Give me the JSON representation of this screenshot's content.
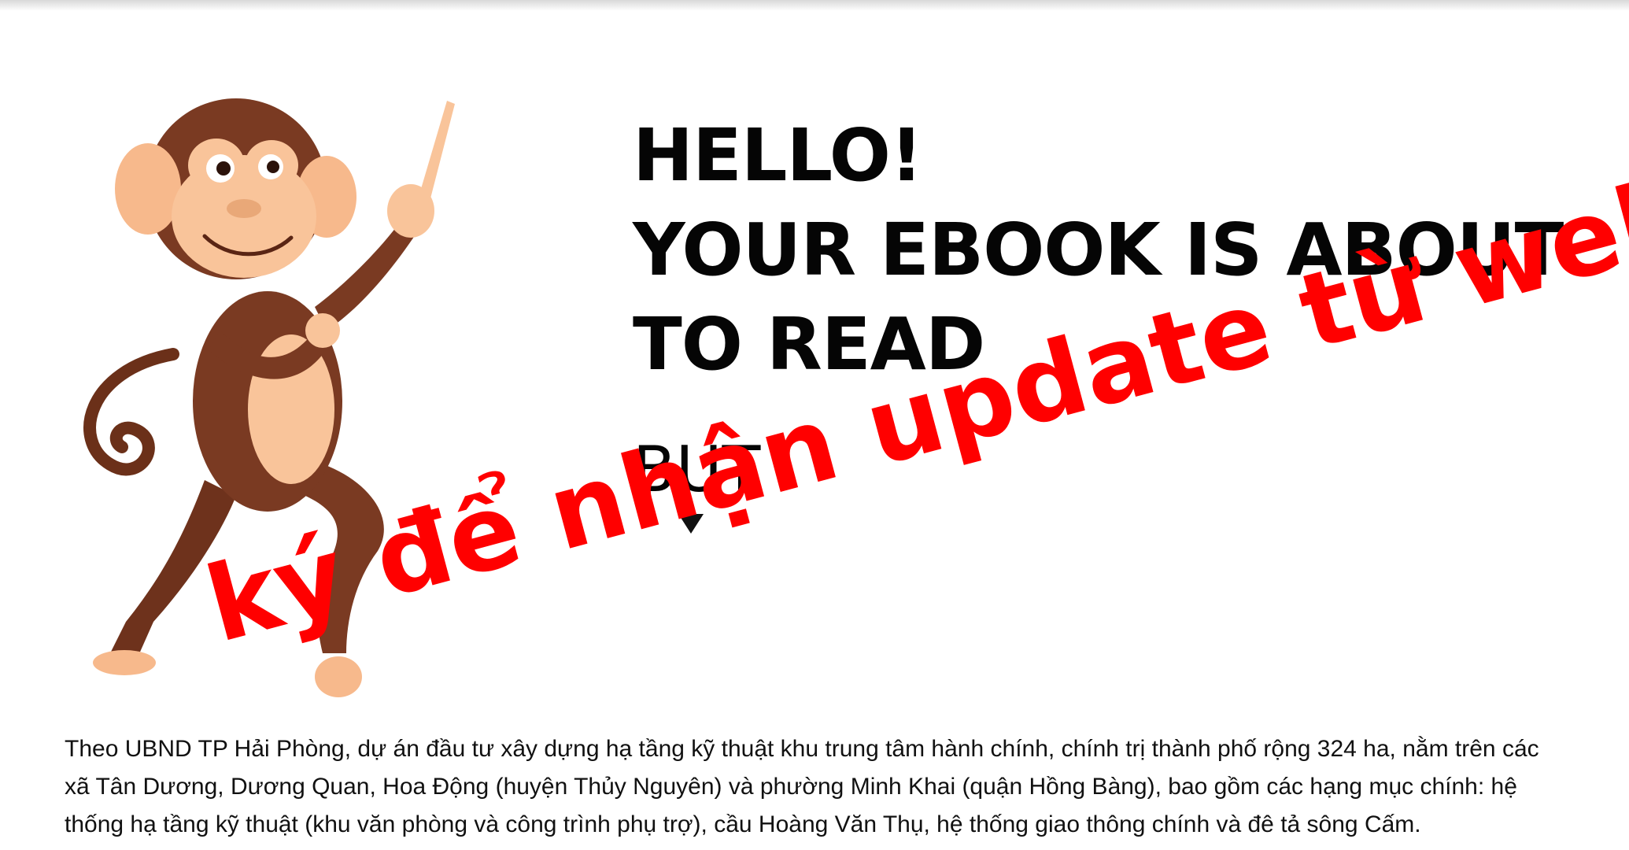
{
  "hero": {
    "title_lines": [
      "HELLO!",
      "YOUR EBOOK IS ABOUT",
      "TO READ"
    ],
    "subtitle": "BUT",
    "arrow_icon": "triangle-down-icon"
  },
  "article": {
    "paragraph": "Theo UBND TP Hải Phòng, dự án đầu tư xây dựng hạ tầng kỹ thuật khu trung tâm hành chính, chính trị thành phố rộng 324 ha, nằm trên các xã Tân Dương, Dương Quan, Hoa Động (huyện Thủy Nguyên) và phường Minh Khai (quận Hồng Bàng), bao gồm các hạng mục chính: hệ thống hạ tầng kỹ thuật (khu văn phòng và công trình phụ trợ), cầu Hoàng Văn Thụ, hệ thống giao thông chính và đê tả sông Cấm."
  },
  "watermark": {
    "text": "ký để nhận update từ website"
  },
  "illustration": {
    "name": "monkey-illustration"
  },
  "colors": {
    "watermark": "#ff0000",
    "monkey_fur": "#7a3a22",
    "monkey_skin": "#f9c49a",
    "text": "#111111"
  }
}
